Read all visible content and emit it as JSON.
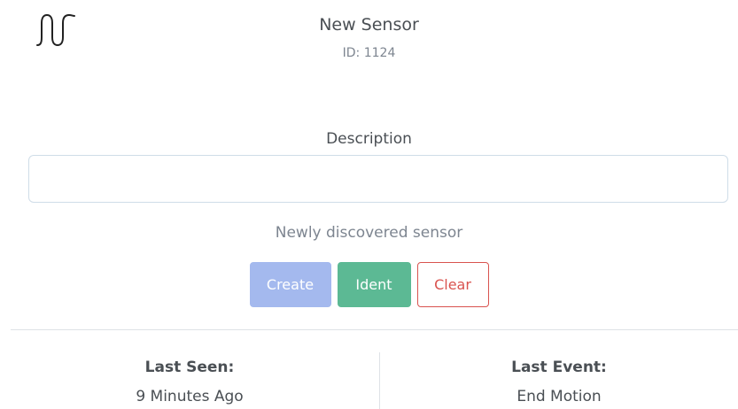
{
  "sensor": {
    "title": "New Sensor",
    "id_text": "ID: 1124",
    "logo_icon": "waveform-logo-icon"
  },
  "description": {
    "label": "Description",
    "value": "",
    "placeholder": "",
    "help_text": "Newly discovered sensor"
  },
  "actions": {
    "create_label": "Create",
    "ident_label": "Ident",
    "clear_label": "Clear"
  },
  "stats": {
    "last_seen_label": "Last Seen:",
    "last_seen_value": "9 Minutes Ago",
    "last_event_label": "Last Event:",
    "last_event_value": "End Motion"
  },
  "colors": {
    "create_button": "#a4b9ee",
    "ident_button": "#5cb994",
    "clear_button_border": "#d9534f",
    "text_primary": "#4a4f54",
    "text_muted": "#7d8590"
  }
}
